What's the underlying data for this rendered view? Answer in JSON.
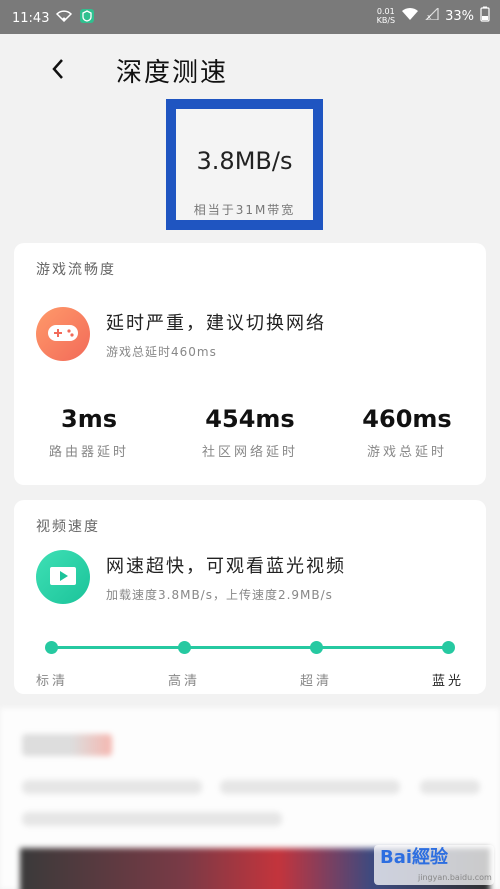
{
  "status_bar": {
    "time": "11:43",
    "net_speed_value": "0.01",
    "net_speed_unit": "KB/S",
    "battery": "33%",
    "icons": [
      "wifi-icon",
      "shield-icon",
      "signal-icon",
      "battery-icon"
    ]
  },
  "header": {
    "title": "深度测速",
    "back_icon": "chevron-left-icon"
  },
  "speed": {
    "value": "3.8MB/s",
    "equivalent": "相当于31M带宽",
    "highlight_color": "#1f55c1"
  },
  "game_card": {
    "title": "游戏流畅度",
    "icon": "gamepad-icon",
    "message": "延时严重，建议切换网络",
    "detail": "游戏总延时460ms",
    "stats": [
      {
        "value": "3ms",
        "label": "路由器延时"
      },
      {
        "value": "454ms",
        "label": "社区网络延时"
      },
      {
        "value": "460ms",
        "label": "游戏总延时"
      }
    ]
  },
  "video_card": {
    "title": "视频速度",
    "icon": "play-icon",
    "message": "网速超快，可观看蓝光视频",
    "detail": "加载速度3.8MB/s，上传速度2.9MB/s",
    "levels": [
      "标清",
      "高清",
      "超清",
      "蓝光"
    ],
    "active_level": "蓝光",
    "accent_color": "#26c9a1"
  },
  "watermark": {
    "brand": "Bai經验",
    "domain": "jingyan.baidu.com"
  }
}
